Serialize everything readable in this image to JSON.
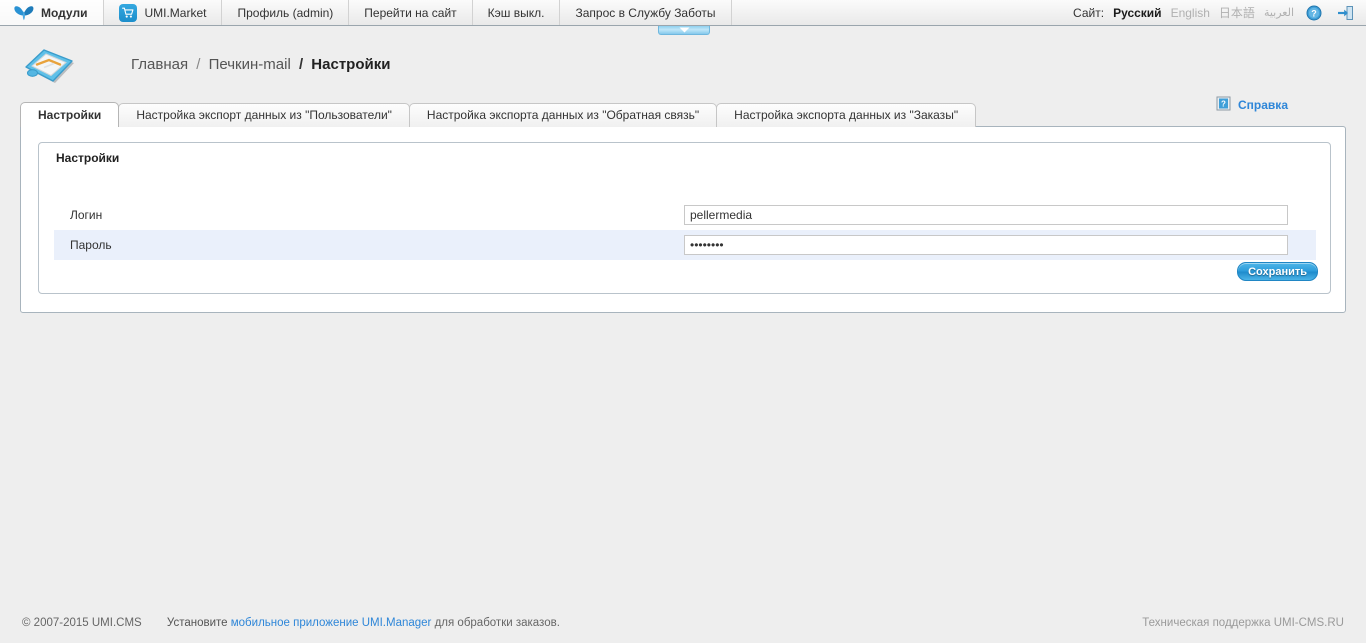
{
  "toolbar": {
    "items": [
      {
        "label": "Модули",
        "icon": "butterfly-icon"
      },
      {
        "label": "UMI.Market",
        "icon": "cart-icon"
      },
      {
        "label": "Профиль (admin)",
        "icon": ""
      },
      {
        "label": "Перейти на сайт",
        "icon": ""
      },
      {
        "label": "Кэш выкл.",
        "icon": ""
      },
      {
        "label": "Запрос в Службу Заботы",
        "icon": ""
      }
    ],
    "site_label": "Сайт:",
    "languages": [
      {
        "label": "Русский",
        "active": true
      },
      {
        "label": "English",
        "active": false
      },
      {
        "label": "日本語",
        "active": false
      },
      {
        "label": "العربية",
        "active": false
      }
    ],
    "help_icon": "question-circle-icon",
    "logout_icon": "logout-icon"
  },
  "header": {
    "module_icon": "mail-tray-icon",
    "breadcrumb": {
      "home": "Главная",
      "module": "Печкин-mail",
      "current": "Настройки",
      "separator": "/"
    },
    "help": {
      "label": "Справка",
      "icon": "help-book-icon"
    }
  },
  "tabs": [
    {
      "label": "Настройки",
      "active": true
    },
    {
      "label": "Настройка экспорт данных из \"Пользователи\"",
      "active": false
    },
    {
      "label": "Настройка экспорта данных из \"Обратная связь\"",
      "active": false
    },
    {
      "label": "Настройка экспорта данных из \"Заказы\"",
      "active": false
    }
  ],
  "panel": {
    "title": "Настройки",
    "fields": [
      {
        "label": "Логин",
        "value": "pellermedia",
        "placeholder": "",
        "type": "text",
        "striped": false
      },
      {
        "label": "Пароль",
        "value": "••••••••",
        "placeholder": "",
        "type": "password",
        "striped": true
      }
    ],
    "save_label": "Сохранить"
  },
  "footer": {
    "copyright": "© 2007-2015 UMI.CMS",
    "install_prefix": "Установите",
    "app_link": "мобильное приложение UMI.Manager",
    "install_suffix": "для обработки заказов.",
    "support": "Техническая поддержка UMI-CMS.RU"
  },
  "colors": {
    "accent": "#2e86d8",
    "button": "#2e9ddb",
    "stripe": "#eaf0fb",
    "page_bg": "#eeeeee"
  }
}
